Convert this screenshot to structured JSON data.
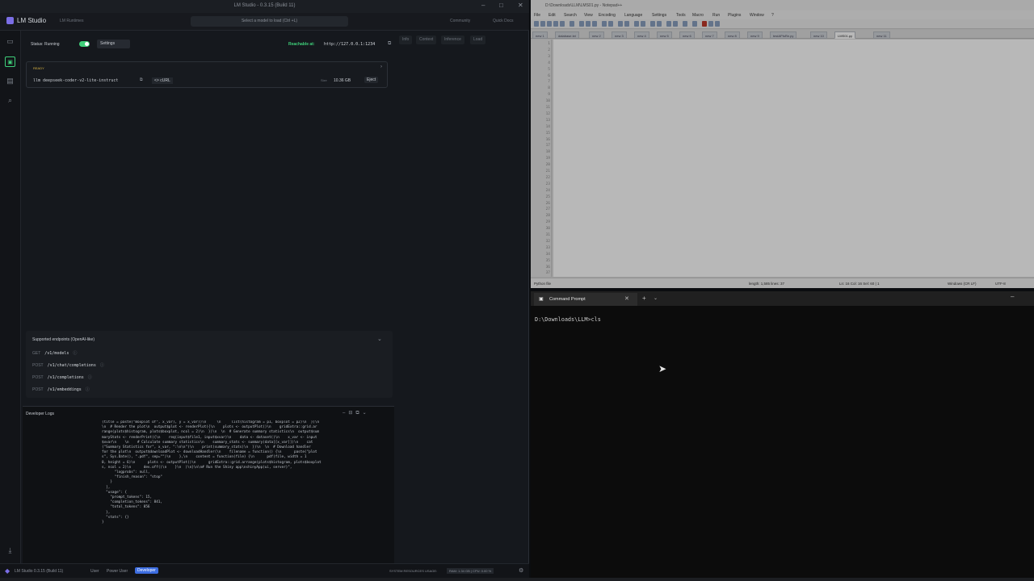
{
  "lm": {
    "title": "LM Studio - 0.3.15 (Build 11)",
    "app_name": "LM Studio",
    "runtimes": "LM Runtimes",
    "model_select": "Select a model to load (Ctrl +L)",
    "community": "Community",
    "quick_docs": "Quick Docs",
    "status_label": "Status: Running",
    "settings_label": "Settings",
    "reachable_label": "Reachable at:",
    "server_url": "http://127.0.0.1:1234",
    "ready_label": "READY",
    "model_id": "llm deepseek-coder-v2-lite-instruct",
    "curl_label": "<> cURL",
    "size_label": "Size",
    "size_value": "10.36 GB",
    "eject_label": "Eject",
    "tabs": [
      "Info",
      "Context",
      "Inference",
      "Load"
    ],
    "endpoints_title": "Supported endpoints (OpenAI-like)",
    "endpoints": [
      {
        "method": "GET",
        "path": "/v1/models"
      },
      {
        "method": "POST",
        "path": "/v1/chat/completions"
      },
      {
        "method": "POST",
        "path": "/v1/completions"
      },
      {
        "method": "POST",
        "path": "/v1/embeddings"
      }
    ],
    "dev_logs_title": "Developer Logs",
    "dev_logs": "(title = paste(\"Boxplot of\", x_var), y = x_var))\\n     \\n     list(histogram = p1, boxplot = p2)\\n  })\\n\n\\n  # Render the plot\\n  output$plot <- renderPlot({\\n    plots <- outputPlot()\\n    gridExtra::grid.ar\nrange(plots$histogram, plots$boxplot, ncol = 2)\\n  })\\n  \\n  # Generate summary statistics\\n  output$sum\nmaryStats <- renderPrint({\\n    req(input$file1, input$xvar)\\n    data <- dataset()\\n    x_var <- input\n$xvar\\n    \\n    # Calculate summary statistics\\n    summary_stats <- summary(data[[x_var]])\\n    cat\n(\"Summary Statistics for\", x_var, \":\\n\\n\")\\n    print(summary_stats)\\n  })\\n  \\n  # Download handler\nfor the plot\\n  output$downloadPlot <- downloadHandler(\\n    filename = function() {\\n      paste(\"plot\ns\", Sys.Date(), \".pdf\", sep=\"\")\\n    },\\n    content = function(file) {\\n      pdf(file, width = 1\n0, height = 6)\\n      plots <- outputPlot()\\n      gridExtra::grid.arrange(plots$histogram, plots$boxplot\ns, ncol = 2)\\n      dev.off()\\n    }\\n  )\\n}\\n\\n# Run the Shiny app\\nshinyApp(ui, server)\",\n      \"logprobs\": null,\n      \"finish_reason\": \"stop\"\n    }\n  ],\n  \"usage\": {\n    \"prompt_tokens\": 15,\n    \"completion_tokens\": 841,\n    \"total_tokens\": 856\n  },\n  \"stats\": {}\n}",
    "status_app": "LM Studio 0.3.15 (Build 11)",
    "status_user": "User",
    "status_power": "Power User",
    "status_dev": "Developer",
    "status_resources": "SYSTEM RESOURCES USAGE:",
    "status_ram": "RAM: 1.34 GB | CPU: 0.00 %"
  },
  "npp": {
    "title": "D:\\Downloads\\LLM\\LMS01.py - Notepad++",
    "menu": [
      "File",
      "Edit",
      "Search",
      "View",
      "Encoding",
      "Language",
      "Settings",
      "Tools",
      "Macro",
      "Run",
      "Plugins",
      "Window",
      "?"
    ],
    "tabs": [
      "new 1",
      "database.txt",
      "new 2",
      "new 3",
      "new 4",
      "new 5",
      "new 6",
      "new 7",
      "new 8",
      "new 9",
      "testAPIsRe.py",
      "new 10",
      "LMS01.py",
      "new 11"
    ],
    "active_tab": "LMS01.py",
    "status_lang": "Python file",
    "status_length": "length: 1,585   lines: 37",
    "status_pos": "Ln: 16   Col: 16   Sel: 60 | 1",
    "status_eol": "Windows (CR LF)",
    "status_enc": "UTF-8"
  },
  "cmd": {
    "tab_title": "Command Prompt",
    "prompt_text": "D:\\Downloads\\LLM>cls"
  }
}
